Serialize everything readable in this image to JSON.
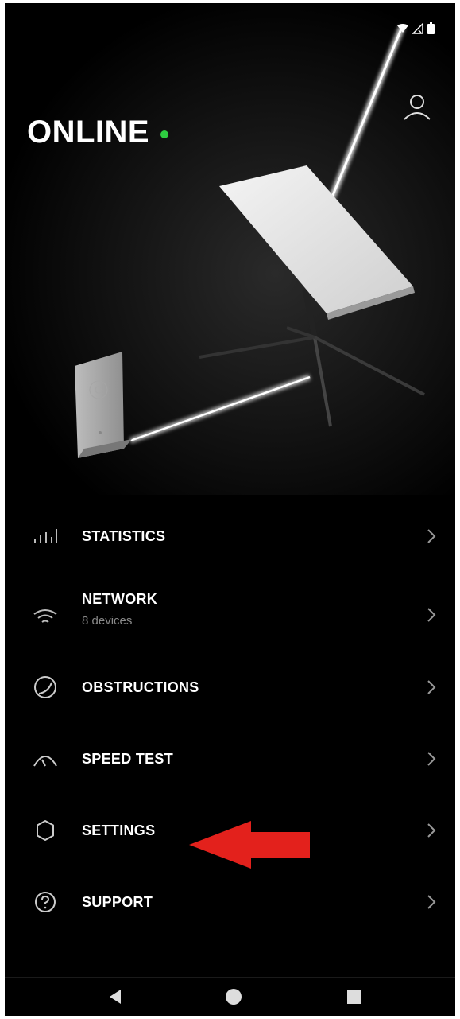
{
  "header": {
    "status_title": "ONLINE",
    "status_color": "#2ecc40"
  },
  "menu": {
    "items": [
      {
        "label": "STATISTICS",
        "icon": "bar-chart-icon"
      },
      {
        "label": "NETWORK",
        "sub": "8 devices",
        "icon": "wifi-icon"
      },
      {
        "label": "OBSTRUCTIONS",
        "icon": "obstruction-circle-icon"
      },
      {
        "label": "SPEED TEST",
        "icon": "speedometer-icon"
      },
      {
        "label": "SETTINGS",
        "icon": "gear-icon"
      },
      {
        "label": "SUPPORT",
        "icon": "help-circle-icon"
      }
    ]
  },
  "annotation": {
    "arrow_color": "#e3211c"
  }
}
